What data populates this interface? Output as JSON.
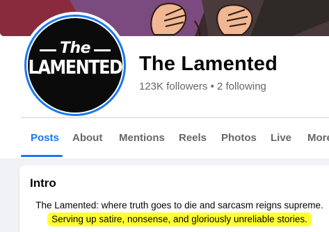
{
  "page": {
    "name": "The Lamented",
    "followers": "123K followers",
    "separator": "•",
    "following": "2 following"
  },
  "logo": {
    "line1": "The",
    "line2": "LAMENTED"
  },
  "tabs": [
    {
      "label": "Posts",
      "active": true
    },
    {
      "label": "About",
      "active": false
    },
    {
      "label": "Mentions",
      "active": false
    },
    {
      "label": "Reels",
      "active": false
    },
    {
      "label": "Photos",
      "active": false
    },
    {
      "label": "Live",
      "active": false
    },
    {
      "label": "More",
      "active": false
    }
  ],
  "intro": {
    "title": "Intro",
    "bio_line1": "The Lamented: where truth goes to die and sarcasm reigns supreme.",
    "bio_line2": "Serving up satire, nonsense, and gloriously unreliable stories."
  },
  "colors": {
    "accent": "#1877f2",
    "highlight": "#ffff33",
    "background": "#f0f2f5"
  }
}
